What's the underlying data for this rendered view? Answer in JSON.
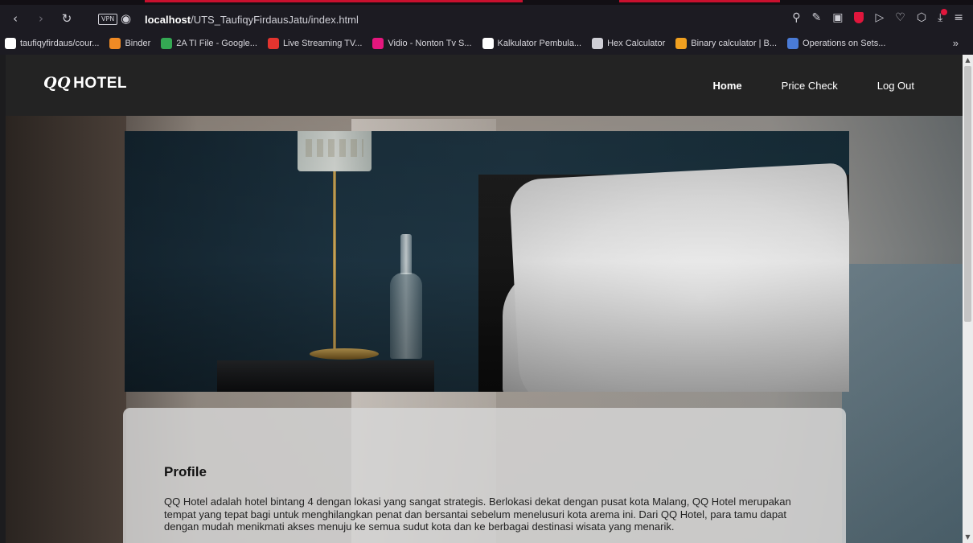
{
  "browser": {
    "url_host": "localhost",
    "url_path": "/UTS_TaufiqyFirdausJatu/index.html",
    "vpn_label": "VPN",
    "bookmarks": [
      {
        "label": "taufiqyfirdaus/cour...",
        "icon": "github-icon",
        "color": "#ffffff"
      },
      {
        "label": "Binder",
        "icon": "binder-icon",
        "color": "#f08a24"
      },
      {
        "label": "2A TI File - Google...",
        "icon": "google-drive-icon",
        "color": "#34a853"
      },
      {
        "label": "Live Streaming TV...",
        "icon": "tv-icon",
        "color": "#e3342f"
      },
      {
        "label": "Vidio - Nonton Tv S...",
        "icon": "vidio-icon",
        "color": "#e5177e"
      },
      {
        "label": "Kalkulator Pembula...",
        "icon": "calculator-l-icon",
        "color": "#ffffff"
      },
      {
        "label": "Hex Calculator",
        "icon": "grid-calculator-icon",
        "color": "#cfcfd6"
      },
      {
        "label": "Binary calculator | B...",
        "icon": "binary-r-icon",
        "color": "#f0a020"
      },
      {
        "label": "Operations on Sets...",
        "icon": "sets-icon",
        "color": "#4a7bd6"
      }
    ],
    "more_label": "»"
  },
  "site": {
    "logo_mark": "QQ",
    "logo_text": "HOTEL",
    "menu": [
      {
        "label": "Home"
      },
      {
        "label": "Price Check"
      },
      {
        "label": "Log Out"
      }
    ]
  },
  "profile": {
    "title": "Profile",
    "body": "QQ Hotel adalah hotel bintang 4 dengan lokasi yang sangat strategis. Berlokasi dekat dengan pusat kota Malang, QQ Hotel merupakan tempat yang tepat bagi untuk menghilangkan penat dan bersantai sebelum menelusuri kota arema ini. Dari QQ Hotel, para tamu dapat dengan mudah menikmati akses menuju ke semua sudut kota dan ke berbagai destinasi wisata yang menarik."
  }
}
